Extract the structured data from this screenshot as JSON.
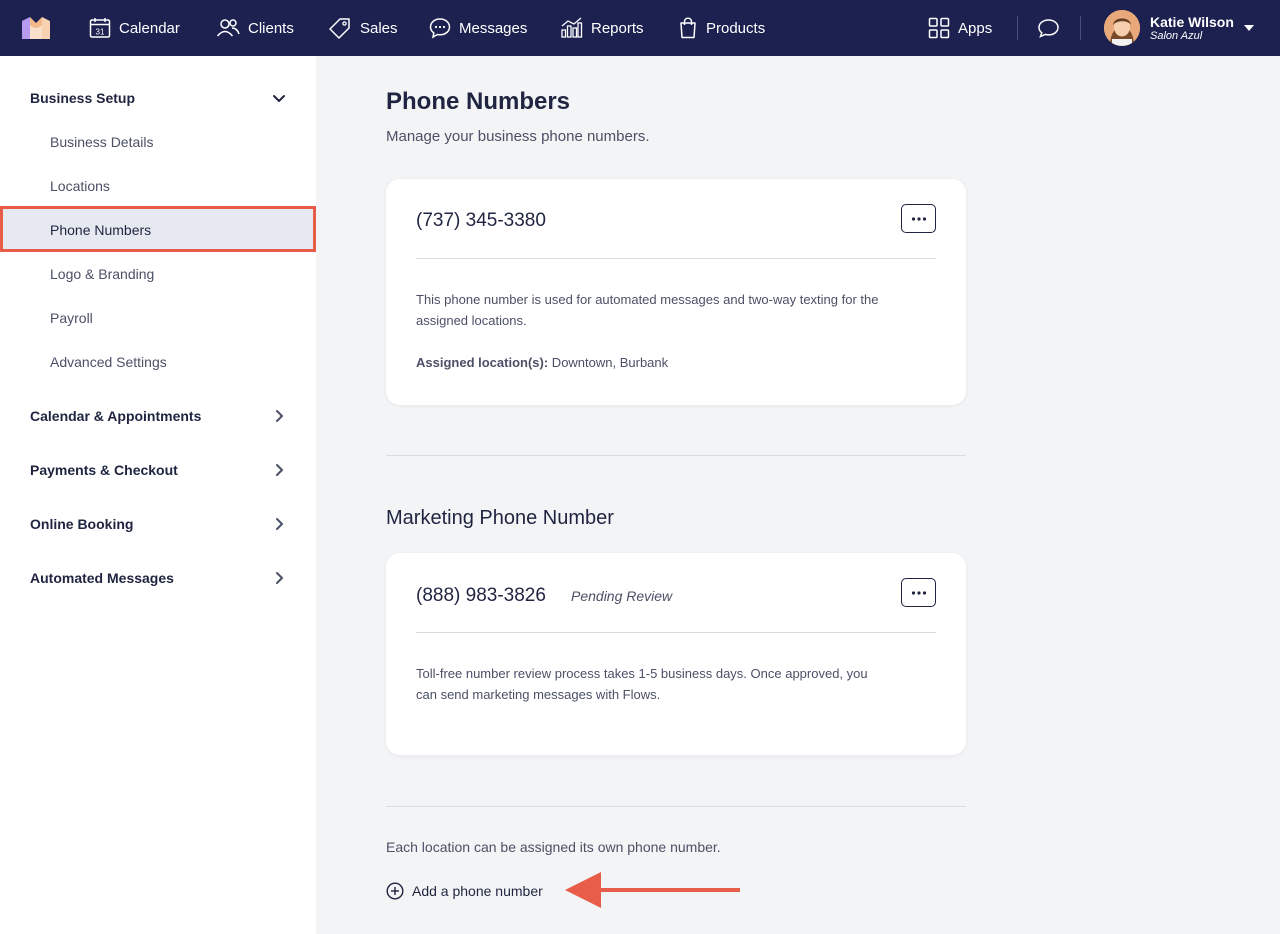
{
  "nav": {
    "items": [
      {
        "label": "Calendar",
        "icon": "calendar-icon"
      },
      {
        "label": "Clients",
        "icon": "clients-icon"
      },
      {
        "label": "Sales",
        "icon": "tag-icon"
      },
      {
        "label": "Messages",
        "icon": "chat-bubble-icon"
      },
      {
        "label": "Reports",
        "icon": "bar-chart-icon"
      },
      {
        "label": "Products",
        "icon": "shopping-bag-icon"
      }
    ],
    "apps_label": "Apps",
    "calendar_day": "31",
    "user": {
      "name": "Katie Wilson",
      "business": "Salon Azul"
    }
  },
  "sidebar": {
    "business_setup": "Business Setup",
    "items": [
      "Business Details",
      "Locations",
      "Phone Numbers",
      "Logo & Branding",
      "Payroll",
      "Advanced Settings"
    ],
    "sections": [
      "Calendar & Appointments",
      "Payments & Checkout",
      "Online Booking",
      "Automated Messages"
    ]
  },
  "main": {
    "title": "Phone Numbers",
    "subtitle": "Manage your business phone numbers.",
    "primary_card": {
      "phone": "(737) 345-3380",
      "description": "This phone number is used for automated messages and two-way texting for the assigned locations.",
      "assigned_label": "Assigned location(s):",
      "assigned_value": " Downtown, Burbank"
    },
    "marketing_title": "Marketing Phone Number",
    "marketing_card": {
      "phone": "(888) 983-3826",
      "status": "Pending Review",
      "description": "Toll-free number review process takes 1-5 business days. Once approved, you can send marketing messages with Flows."
    },
    "footer_note": "Each location can be assigned its own phone number.",
    "add_label": "Add a phone number"
  },
  "colors": {
    "nav_bg": "#1c2150",
    "highlight": "#e85c4a",
    "page_bg": "#f3f4f6",
    "active_item_bg": "#e7e9f1"
  }
}
